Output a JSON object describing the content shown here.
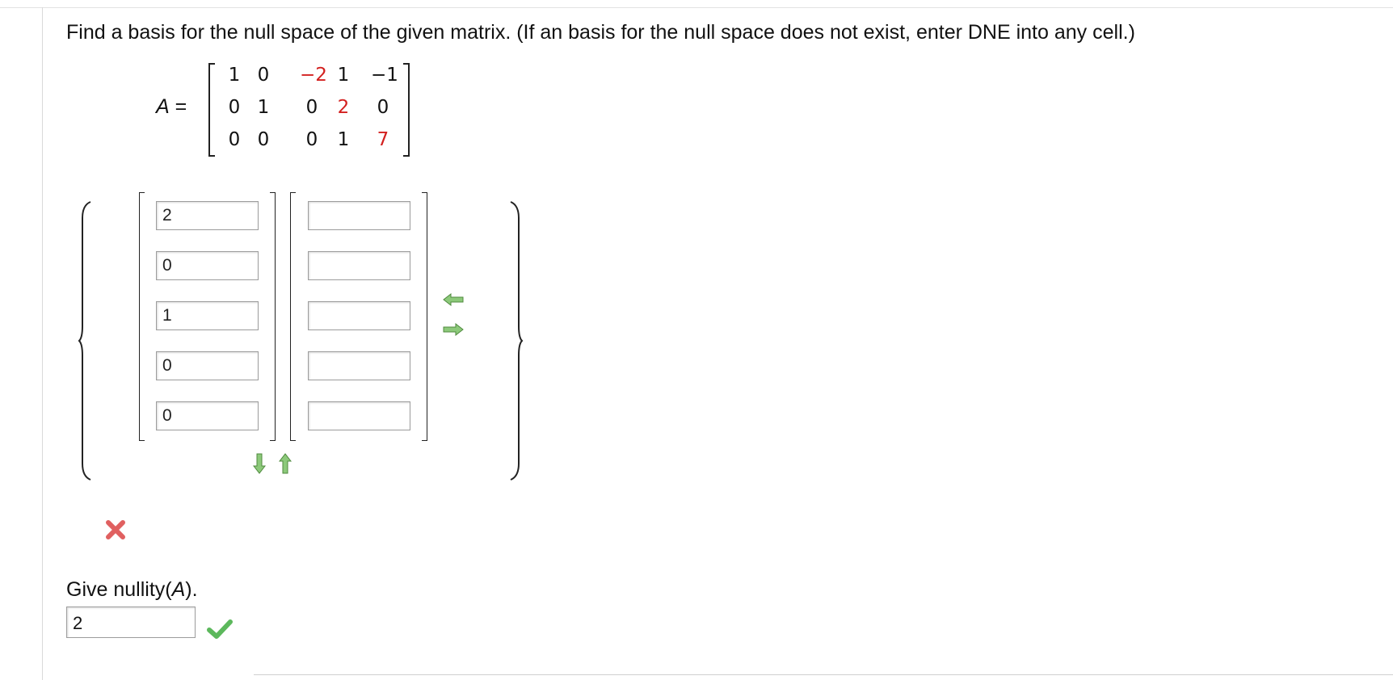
{
  "question": {
    "text": "Find a basis for the null space of the given matrix. (If an basis for the null space does not exist, enter DNE into any cell.)"
  },
  "matrix": {
    "label": "A",
    "equals": "=",
    "rows": [
      [
        "1",
        "0",
        "−2",
        "1",
        "−1"
      ],
      [
        "0",
        "1",
        "0",
        "2",
        "0"
      ],
      [
        "0",
        "0",
        "0",
        "1",
        "7"
      ]
    ],
    "highlight_color": "#d3201f"
  },
  "basis": {
    "vector1": [
      "2",
      "0",
      "1",
      "0",
      "0"
    ],
    "vector2": [
      "",
      "",
      "",
      "",
      ""
    ]
  },
  "basis_result": {
    "status": "incorrect",
    "icon": "red-x-icon"
  },
  "nullity": {
    "prompt_prefix": "Give nullity(",
    "prompt_var": "A",
    "prompt_suffix": ").",
    "value": "2",
    "status": "correct",
    "icon": "green-check-icon"
  },
  "colors": {
    "arrow_green": "#6aa84f",
    "error_red": "#e06060",
    "check_green": "#5cb85c"
  }
}
